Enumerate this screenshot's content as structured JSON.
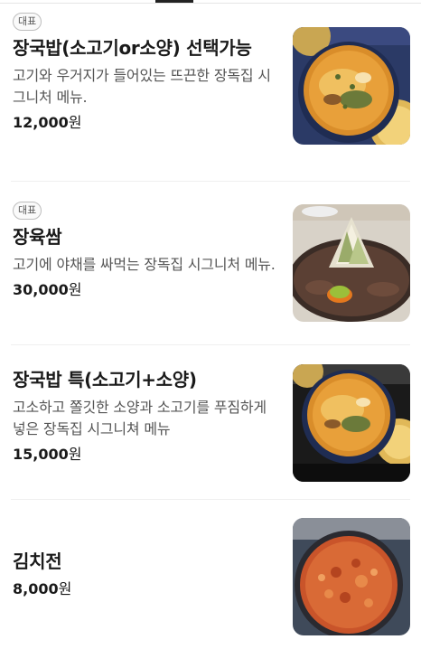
{
  "menu": {
    "items": [
      {
        "badge": "대표",
        "name": "장국밥(소고기or소양) 선택가능",
        "description": "고기와 우거지가 들어있는 뜨끈한 장독집 시그니처 메뉴.",
        "price": "12,000",
        "currency": "원",
        "image_icon": "gukbap-photo"
      },
      {
        "badge": "대표",
        "name": "장육쌈",
        "description": "고기에 야채를 싸먹는 장독집 시그니처 메뉴.",
        "price": "30,000",
        "currency": "원",
        "image_icon": "jangyuk-ssam-photo"
      },
      {
        "name": "장국밥 특(소고기+소양)",
        "description": "고소하고 쫄깃한 소양과 소고기를 푸짐하게넣은 장독집 시그니쳐 메뉴",
        "price": "15,000",
        "currency": "원",
        "image_icon": "gukbap-special-photo"
      },
      {
        "name": "김치전",
        "price": "8,000",
        "currency": "원",
        "image_icon": "kimchijeon-photo"
      }
    ]
  }
}
